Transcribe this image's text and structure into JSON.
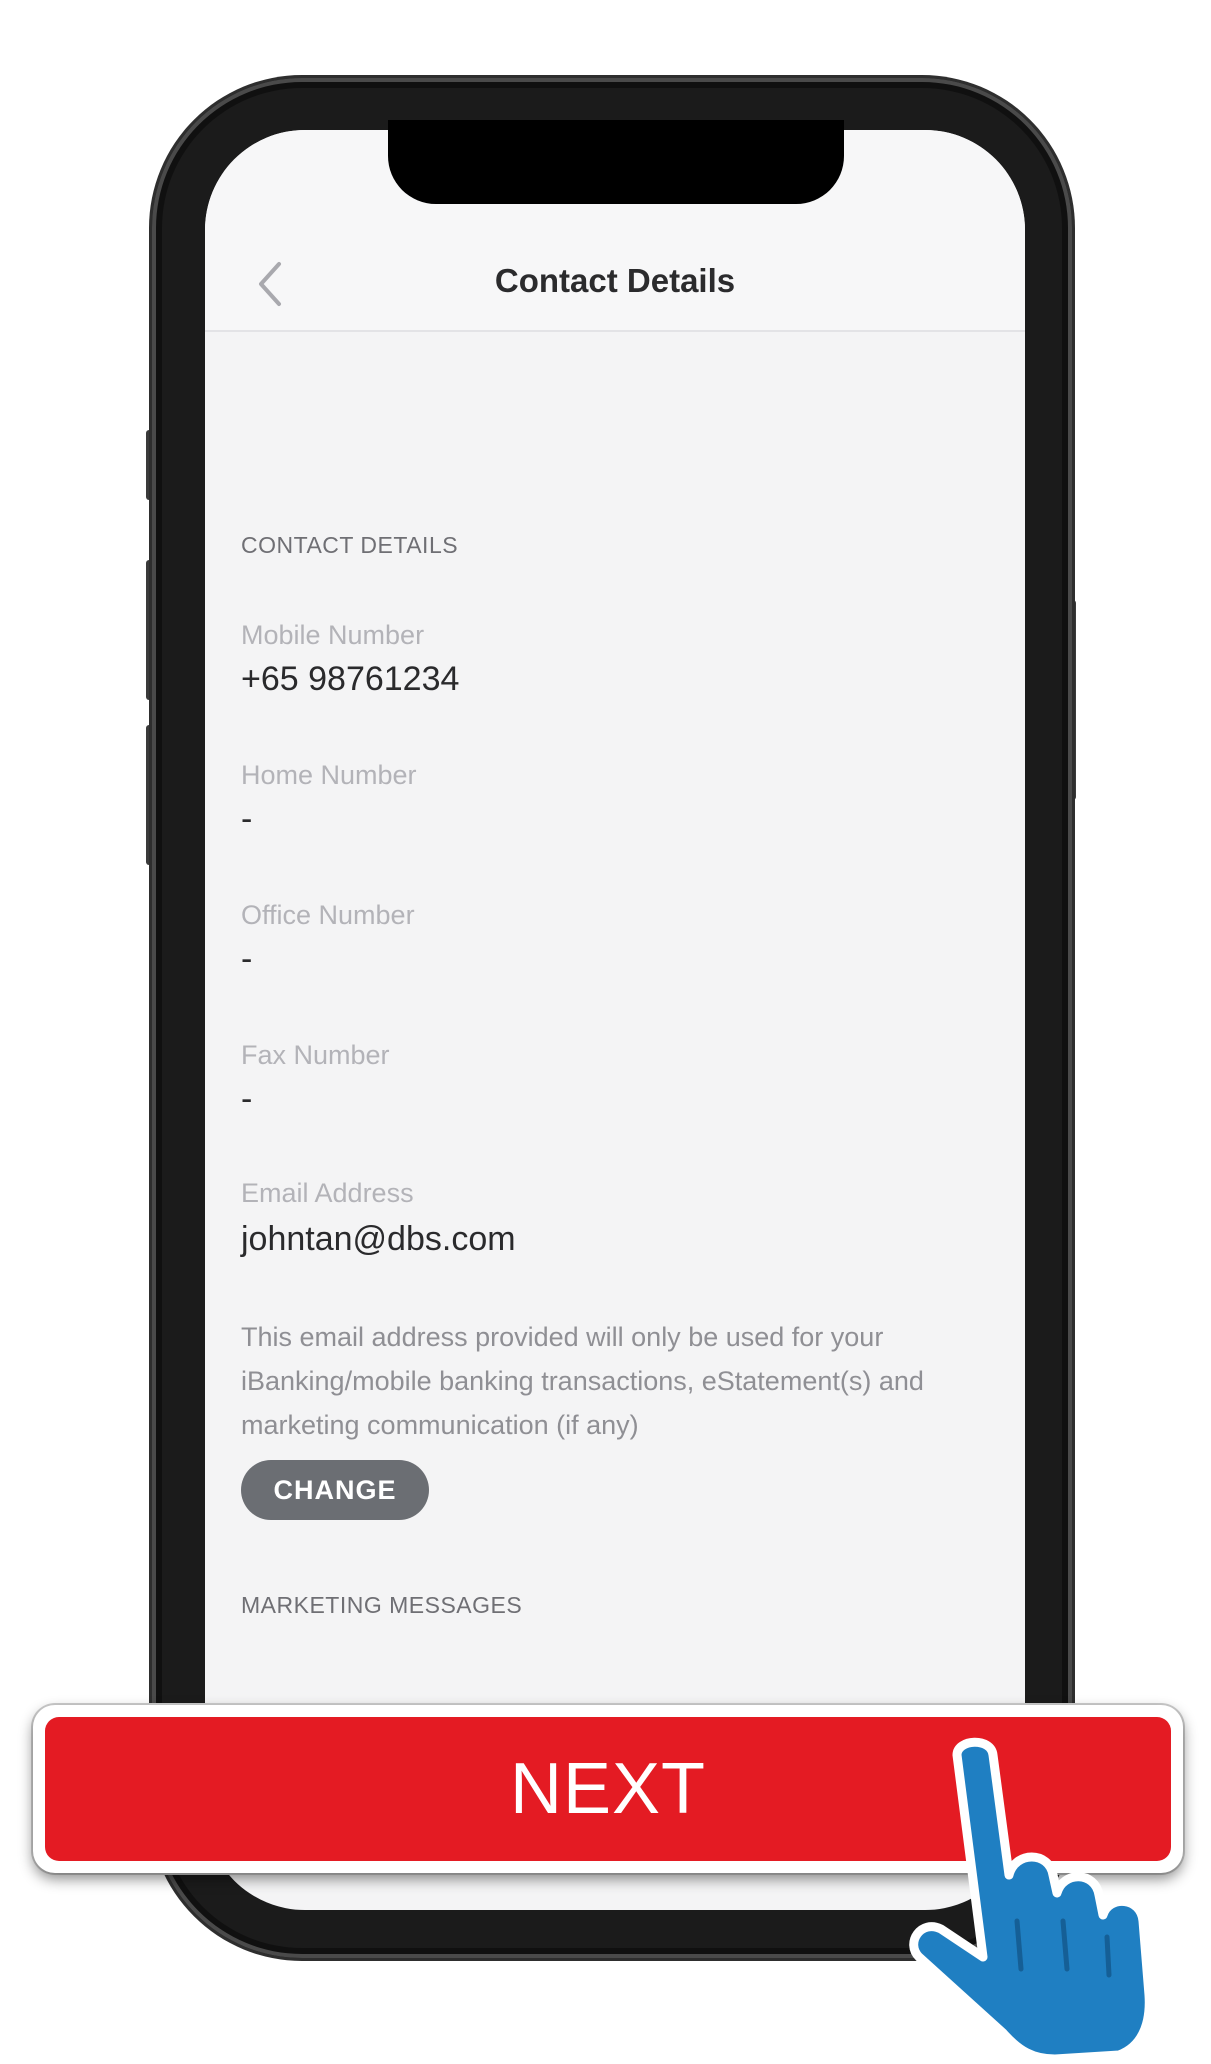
{
  "header": {
    "title": "Contact Details",
    "back_icon": "chevron-left-icon"
  },
  "contact_section": {
    "heading": "CONTACT DETAILS",
    "fields": [
      {
        "label": "Mobile Number",
        "value": "+65 98761234"
      },
      {
        "label": "Home Number",
        "value": "-"
      },
      {
        "label": "Office Number",
        "value": "-"
      },
      {
        "label": "Fax Number",
        "value": "-"
      },
      {
        "label": "Email Address",
        "value": "johntan@dbs.com"
      }
    ],
    "disclaimer": "This email address provided will only be used for your iBanking/mobile banking transactions, eStatement(s) and marketing communication (if any)",
    "change_label": "CHANGE"
  },
  "marketing_section": {
    "heading": "MARKETING MESSAGES"
  },
  "next_button": {
    "label": "NEXT"
  },
  "pointer_icon": "hand-pointer-icon",
  "colors": {
    "next_red": "#e41b23",
    "change_gray": "#6b6e73",
    "hand_blue": "#1f7fc2"
  }
}
